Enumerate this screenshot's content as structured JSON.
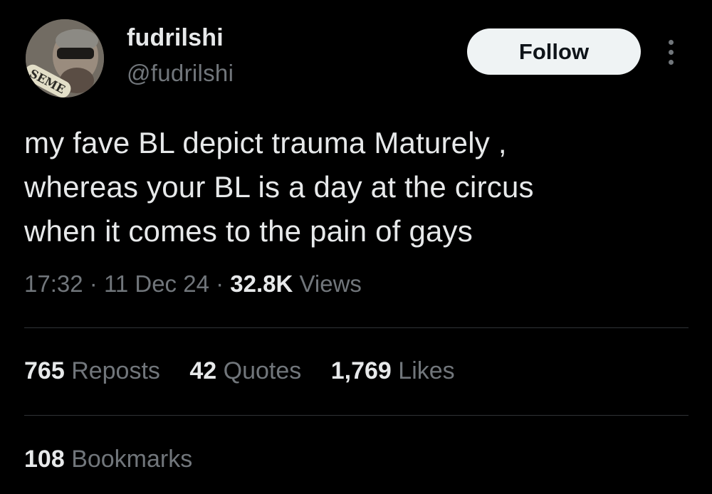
{
  "user": {
    "display_name": "fudrilshi",
    "handle": "@fudrilshi",
    "avatar_badge_text": "SEME"
  },
  "actions": {
    "follow_label": "Follow",
    "more_icon": "more-vertical-icon"
  },
  "tweet": {
    "lines": [
      "my fave BL depict trauma Maturely ,",
      "whereas your BL is a day at the circus",
      "when it comes to the pain of gays"
    ]
  },
  "meta": {
    "time": "17:32",
    "separator": "·",
    "date": "11 Dec 24",
    "views_count": "32.8K",
    "views_label": "Views"
  },
  "stats": {
    "reposts": {
      "count": "765",
      "label": "Reposts"
    },
    "quotes": {
      "count": "42",
      "label": "Quotes"
    },
    "likes": {
      "count": "1,769",
      "label": "Likes"
    },
    "bookmarks": {
      "count": "108",
      "label": "Bookmarks"
    }
  },
  "colors": {
    "background": "#000000",
    "primary_text": "#e7e9ea",
    "secondary_text": "#71767b",
    "divider": "#2f3336",
    "follow_bg": "#eff3f4"
  }
}
